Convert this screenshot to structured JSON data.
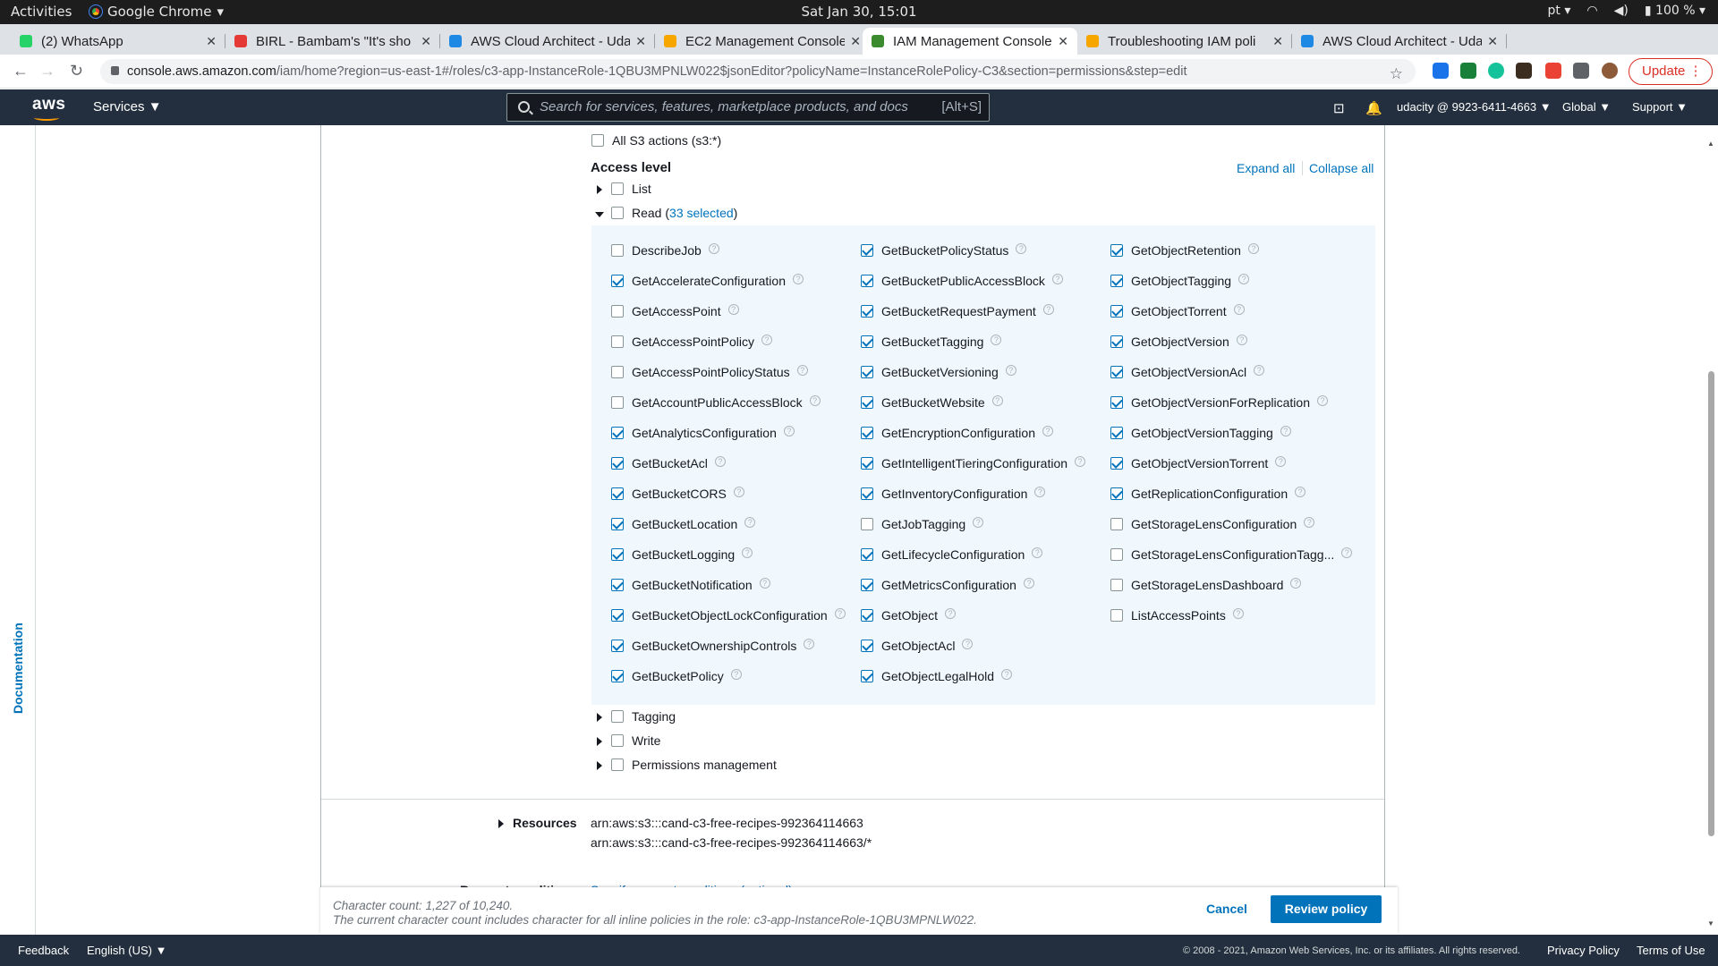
{
  "os_bar": {
    "activities": "Activities",
    "app": "Google Chrome",
    "clock": "Sat Jan 30, 15:01",
    "lang": "pt",
    "battery": "100 %"
  },
  "tabs": [
    {
      "title": "(2) WhatsApp",
      "color": "#25d366"
    },
    {
      "title": "BIRL - Bambam's \"It's sho",
      "color": "#e53935"
    },
    {
      "title": "AWS Cloud Architect - Uda",
      "color": "#1e88e5"
    },
    {
      "title": "EC2 Management Console",
      "color": "#f7a600"
    },
    {
      "title": "IAM Management Console",
      "color": "#3c8a2e"
    },
    {
      "title": "Troubleshooting IAM poli",
      "color": "#f7a600"
    },
    {
      "title": "AWS Cloud Architect - Uda",
      "color": "#1e88e5"
    }
  ],
  "omnibox": {
    "domain": "console.aws.amazon.com",
    "path": "/iam/home?region=us-east-1#/roles/c3-app-InstanceRole-1QBU3MPNLW022$jsonEditor?policyName=InstanceRolePolicy-C3&section=permissions&step=edit",
    "update_label": "Update"
  },
  "aws_nav": {
    "logo": "aws",
    "services": "Services",
    "search_placeholder": "Search for services, features, marketplace products, and docs",
    "search_shortcut": "[Alt+S]",
    "account": "udacity @ 9923-6411-4663",
    "region": "Global",
    "support": "Support"
  },
  "sidebar": {
    "documentation": "Documentation"
  },
  "editor": {
    "all_actions": "All S3 actions (s3:*)",
    "access_level": "Access level",
    "expand_all": "Expand all",
    "collapse_all": "Collapse all",
    "groups": [
      {
        "label": "List",
        "expanded": false
      },
      {
        "label": "Read",
        "expanded": true,
        "selected_text": "33 selected"
      },
      {
        "label": "Tagging",
        "expanded": false
      },
      {
        "label": "Write",
        "expanded": false
      },
      {
        "label": "Permissions management",
        "expanded": false
      }
    ],
    "read_actions": [
      [
        {
          "name": "DescribeJob",
          "checked": false
        },
        {
          "name": "GetAccelerateConfiguration",
          "checked": true
        },
        {
          "name": "GetAccessPoint",
          "checked": false
        },
        {
          "name": "GetAccessPointPolicy",
          "checked": false
        },
        {
          "name": "GetAccessPointPolicyStatus",
          "checked": false
        },
        {
          "name": "GetAccountPublicAccessBlock",
          "checked": false
        },
        {
          "name": "GetAnalyticsConfiguration",
          "checked": true
        },
        {
          "name": "GetBucketAcl",
          "checked": true
        },
        {
          "name": "GetBucketCORS",
          "checked": true
        },
        {
          "name": "GetBucketLocation",
          "checked": true
        },
        {
          "name": "GetBucketLogging",
          "checked": true
        },
        {
          "name": "GetBucketNotification",
          "checked": true
        },
        {
          "name": "GetBucketObjectLockConfiguration",
          "checked": true
        },
        {
          "name": "GetBucketOwnershipControls",
          "checked": true
        },
        {
          "name": "GetBucketPolicy",
          "checked": true
        }
      ],
      [
        {
          "name": "GetBucketPolicyStatus",
          "checked": true
        },
        {
          "name": "GetBucketPublicAccessBlock",
          "checked": true
        },
        {
          "name": "GetBucketRequestPayment",
          "checked": true
        },
        {
          "name": "GetBucketTagging",
          "checked": true
        },
        {
          "name": "GetBucketVersioning",
          "checked": true
        },
        {
          "name": "GetBucketWebsite",
          "checked": true
        },
        {
          "name": "GetEncryptionConfiguration",
          "checked": true
        },
        {
          "name": "GetIntelligentTieringConfiguration",
          "checked": true
        },
        {
          "name": "GetInventoryConfiguration",
          "checked": true
        },
        {
          "name": "GetJobTagging",
          "checked": false
        },
        {
          "name": "GetLifecycleConfiguration",
          "checked": true
        },
        {
          "name": "GetMetricsConfiguration",
          "checked": true
        },
        {
          "name": "GetObject",
          "checked": true
        },
        {
          "name": "GetObjectAcl",
          "checked": true
        },
        {
          "name": "GetObjectLegalHold",
          "checked": true
        }
      ],
      [
        {
          "name": "GetObjectRetention",
          "checked": true
        },
        {
          "name": "GetObjectTagging",
          "checked": true
        },
        {
          "name": "GetObjectTorrent",
          "checked": true
        },
        {
          "name": "GetObjectVersion",
          "checked": true
        },
        {
          "name": "GetObjectVersionAcl",
          "checked": true
        },
        {
          "name": "GetObjectVersionForReplication",
          "checked": true
        },
        {
          "name": "GetObjectVersionTagging",
          "checked": true
        },
        {
          "name": "GetObjectVersionTorrent",
          "checked": true
        },
        {
          "name": "GetReplicationConfiguration",
          "checked": true
        },
        {
          "name": "GetStorageLensConfiguration",
          "checked": false
        },
        {
          "name": "GetStorageLensConfigurationTagg...",
          "checked": false
        },
        {
          "name": "GetStorageLensDashboard",
          "checked": false
        },
        {
          "name": "ListAccessPoints",
          "checked": false
        }
      ]
    ],
    "resources_label": "Resources",
    "resources": [
      "arn:aws:s3:::cand-c3-free-recipes-992364114663",
      "arn:aws:s3:::cand-c3-free-recipes-992364114663/*"
    ],
    "request_conditions_label": "Request conditions",
    "request_conditions_link": "Specify request conditions (optional)"
  },
  "footer_actions": {
    "char_count": "Character count: 1,227 of 10,240.",
    "char_note": "The current character count includes character for all inline policies in the role: c3-app-InstanceRole-1QBU3MPNLW022.",
    "cancel": "Cancel",
    "review": "Review policy"
  },
  "bottom_bar": {
    "feedback": "Feedback",
    "language": "English (US)",
    "copyright": "© 2008 - 2021, Amazon Web Services, Inc. or its affiliates. All rights reserved.",
    "privacy": "Privacy Policy",
    "terms": "Terms of Use"
  }
}
